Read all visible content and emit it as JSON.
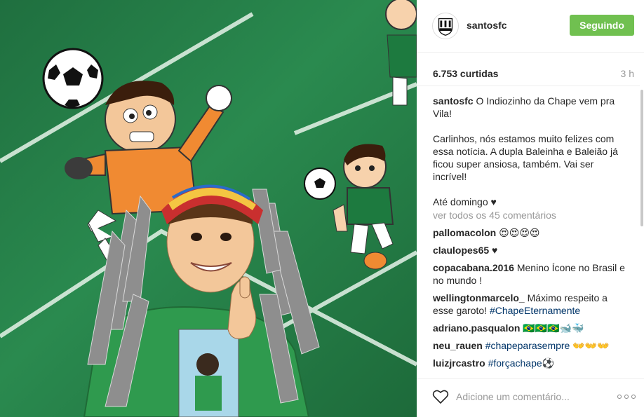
{
  "post": {
    "username": "santosfc",
    "follow_label": "Seguindo",
    "likes": "6.753 curtidas",
    "time": "3 h",
    "avatar_text": "SantosFC",
    "caption": {
      "author": "santosfc",
      "line1": "O Indiozinho da Chape vem pra Vila!",
      "line2": "Carlinhos, nós estamos muito felizes com essa notícia. A dupla Baleinha e Baleião já ficou super ansiosa, também. Vai ser incrível!",
      "line3": "Até domingo ♥"
    },
    "view_all": "ver todos os 45 comentários",
    "comments": [
      {
        "author": "pallomacolon",
        "text": "😍😍😍😍"
      },
      {
        "author": "claulopes65",
        "text": "♥"
      },
      {
        "author": "copacabana.2016",
        "text": "Menino Ícone no Brasil e no mundo !"
      },
      {
        "author": "wellingtonmarcelo_",
        "text": "Máximo respeito a esse garoto!",
        "hashtag": "#ChapeEternamente"
      },
      {
        "author": "adriano.pasqualon",
        "text": "🇧🇷🇧🇷🇧🇷🐋🐳"
      },
      {
        "author": "neu_rauen",
        "hashtag": "#chapeparasempre",
        "text": "👐👐👐"
      },
      {
        "author": "luizjrcastro",
        "hashtag": "#forçachape",
        "text": "⚽"
      }
    ],
    "add_comment_placeholder": "Adicione um comentário...",
    "icons": {
      "like": "heart-icon",
      "options": "more-options-icon"
    },
    "colors": {
      "follow_button": "#70c050",
      "hashtag": "#003569",
      "muted": "#999999"
    }
  }
}
